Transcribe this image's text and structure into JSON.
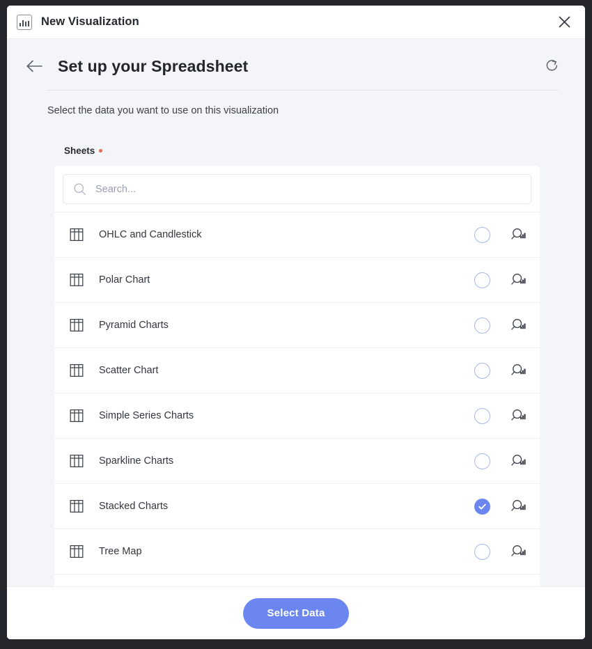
{
  "window": {
    "title": "New Visualization",
    "app_icon": "bar-chart-icon",
    "close_icon": "close-icon"
  },
  "page": {
    "back_icon": "arrow-left-icon",
    "title": "Set up your Spreadsheet",
    "refresh_icon": "refresh-icon",
    "subtitle": "Select the data you want to use on this visualization"
  },
  "field": {
    "label": "Sheets",
    "required_marker": "•"
  },
  "search": {
    "icon": "search-icon",
    "value": "",
    "placeholder": "Search..."
  },
  "sheets": [
    {
      "name": "OHLC and Candlestick",
      "icon": "table-icon",
      "selected": false,
      "preview_icon": "preview-data-icon"
    },
    {
      "name": "Polar Chart",
      "icon": "table-icon",
      "selected": false,
      "preview_icon": "preview-data-icon"
    },
    {
      "name": "Pyramid Charts",
      "icon": "table-icon",
      "selected": false,
      "preview_icon": "preview-data-icon"
    },
    {
      "name": "Scatter Chart",
      "icon": "table-icon",
      "selected": false,
      "preview_icon": "preview-data-icon"
    },
    {
      "name": "Simple Series Charts",
      "icon": "table-icon",
      "selected": false,
      "preview_icon": "preview-data-icon"
    },
    {
      "name": "Sparkline Charts",
      "icon": "table-icon",
      "selected": false,
      "preview_icon": "preview-data-icon"
    },
    {
      "name": "Stacked Charts",
      "icon": "table-icon",
      "selected": true,
      "preview_icon": "preview-data-icon"
    },
    {
      "name": "Tree Map",
      "icon": "table-icon",
      "selected": false,
      "preview_icon": "preview-data-icon"
    }
  ],
  "footer": {
    "primary_button": "Select Data"
  },
  "colors": {
    "accent": "#6c86ef",
    "radio_border": "#a9b6ee",
    "required_dot": "#e8705f",
    "body_bg": "#f4f5f9",
    "panel_bg": "#ffffff",
    "text_primary": "#22262d",
    "placeholder": "#9aa0b0"
  }
}
